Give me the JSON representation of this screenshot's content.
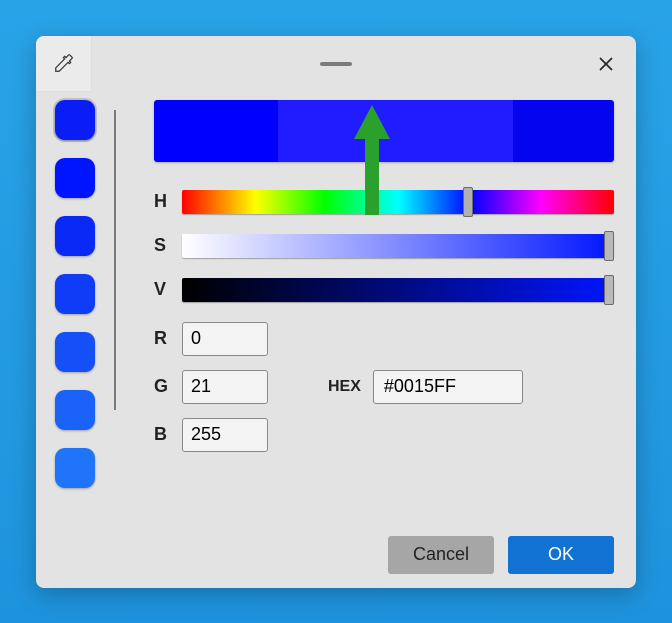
{
  "swatches": [
    {
      "color": "#0a1df7",
      "selected": true
    },
    {
      "color": "#0015ff"
    },
    {
      "color": "#0a29f5"
    },
    {
      "color": "#0f3cf6"
    },
    {
      "color": "#154ff7"
    },
    {
      "color": "#1b62f8"
    },
    {
      "color": "#2074f9"
    }
  ],
  "sliders": {
    "hue": {
      "label": "H",
      "thumb_pct": 65
    },
    "saturation": {
      "label": "S",
      "thumb_pct": 100
    },
    "value": {
      "label": "V",
      "thumb_pct": 100
    }
  },
  "rgb": {
    "r_label": "R",
    "r_value": "0",
    "g_label": "G",
    "g_value": "21",
    "b_label": "B",
    "b_value": "255"
  },
  "hex": {
    "label": "HEX",
    "value": "#0015FF"
  },
  "buttons": {
    "cancel": "Cancel",
    "ok": "OK"
  },
  "preview_color": "#201cff"
}
